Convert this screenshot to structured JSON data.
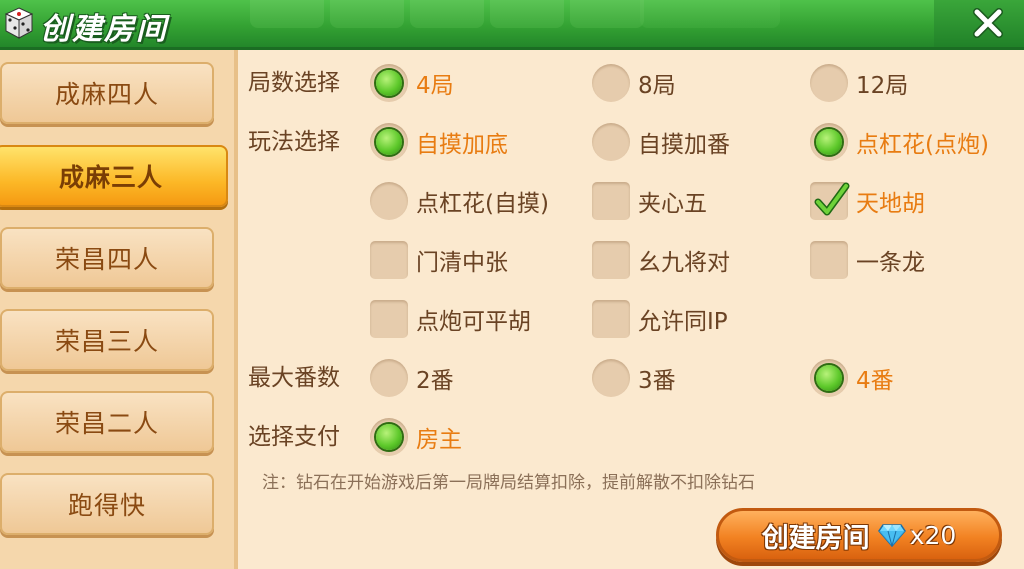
{
  "header": {
    "title": "创建房间"
  },
  "sidebar": {
    "tabs": [
      {
        "label": "成麻四人",
        "active": false
      },
      {
        "label": "成麻三人",
        "active": true
      },
      {
        "label": "荣昌四人",
        "active": false
      },
      {
        "label": "荣昌三人",
        "active": false
      },
      {
        "label": "荣昌二人",
        "active": false
      },
      {
        "label": "跑得快",
        "active": false
      }
    ]
  },
  "rounds": {
    "label": "局数选择",
    "options": [
      {
        "label": "4局",
        "selected": true
      },
      {
        "label": "8局",
        "selected": false
      },
      {
        "label": "12局",
        "selected": false
      }
    ]
  },
  "rules": {
    "label": "玩法选择",
    "options": [
      {
        "label": "自摸加底",
        "selected": true
      },
      {
        "label": "自摸加番",
        "selected": false
      },
      {
        "label": "点杠花(点炮)",
        "selected": true
      },
      {
        "label": "点杠花(自摸)",
        "selected": false
      }
    ],
    "checkboxes": [
      {
        "label": "夹心五",
        "checked": false
      },
      {
        "label": "天地胡",
        "checked": true
      },
      {
        "label": "门清中张",
        "checked": false
      },
      {
        "label": "幺九将对",
        "checked": false
      },
      {
        "label": "一条龙",
        "checked": false
      },
      {
        "label": "点炮可平胡",
        "checked": false
      },
      {
        "label": "允许同IP",
        "checked": false
      }
    ]
  },
  "max_fan": {
    "label": "最大番数",
    "options": [
      {
        "label": "2番",
        "selected": false
      },
      {
        "label": "3番",
        "selected": false
      },
      {
        "label": "4番",
        "selected": true
      }
    ]
  },
  "payment": {
    "label": "选择支付",
    "options": [
      {
        "label": "房主",
        "selected": true
      }
    ]
  },
  "note": "注：钻石在开始游戏后第一局牌局结算扣除，提前解散不扣除钻石",
  "create_button": {
    "label": "创建房间",
    "cost": "x20"
  },
  "colors": {
    "accent": "#e87c12",
    "header_green": "#34a233",
    "text": "#6a4324"
  }
}
